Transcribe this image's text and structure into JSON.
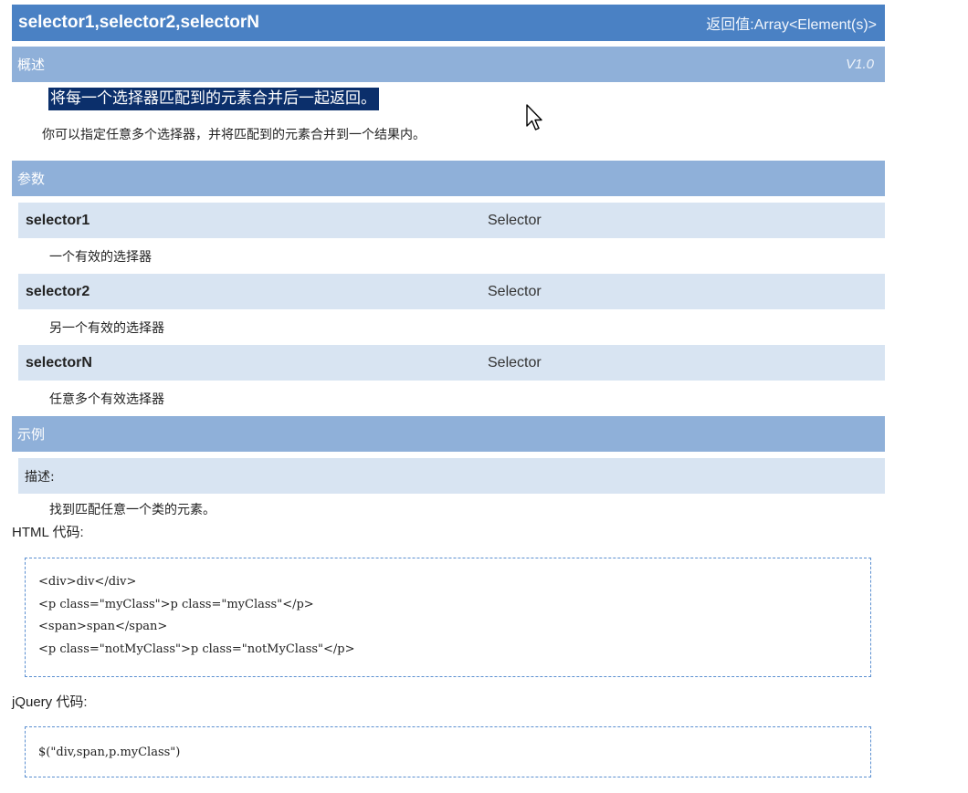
{
  "header": {
    "signature": "selector1,selector2,selectorN",
    "return_value": "返回值:Array<Element(s)>"
  },
  "overview": {
    "title": "概述",
    "version": "V1.0",
    "highlighted": "将每一个选择器匹配到的元素合并后一起返回。",
    "text": "你可以指定任意多个选择器，并将匹配到的元素合并到一个结果内。"
  },
  "params": {
    "title": "参数",
    "items": [
      {
        "name": "selector1",
        "type": "Selector",
        "desc": "一个有效的选择器"
      },
      {
        "name": "selector2",
        "type": "Selector",
        "desc": "另一个有效的选择器"
      },
      {
        "name": "selectorN",
        "type": "Selector",
        "desc": "任意多个有效选择器"
      }
    ]
  },
  "example": {
    "title": "示例",
    "desc_label": "描述:",
    "desc_text": "找到匹配任意一个类的元素。",
    "html_label": "HTML 代码:",
    "html_lines": [
      "<div>div</div>",
      "<p class=\"myClass\">p class=\"myClass\"</p>",
      "<span>span</span>",
      "<p class=\"notMyClass\">p class=\"notMyClass\"</p>"
    ],
    "jquery_label": "jQuery 代码:",
    "jquery_code": "$(\"div,span,p.myClass\")"
  },
  "colors": {
    "title_bar": "#4a81c4",
    "section_bar": "#8fb0d9",
    "param_row": "#d8e4f2",
    "highlight": "#0b2f6b",
    "code_border": "#5b8fd0"
  },
  "icons": {
    "cursor": "mouse-pointer-icon"
  }
}
